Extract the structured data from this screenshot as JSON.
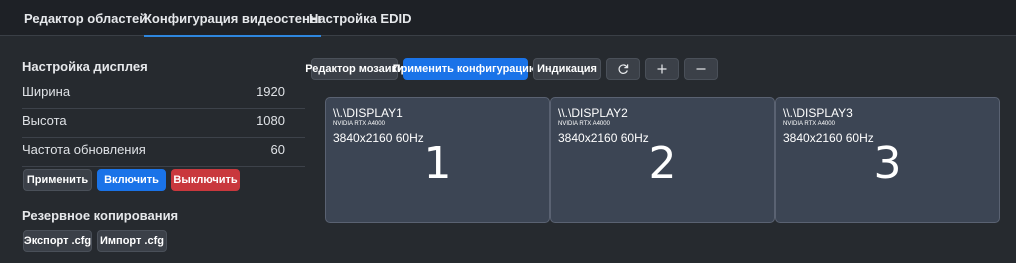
{
  "tabs": [
    {
      "label": "Редактор областей",
      "active": false
    },
    {
      "label": "Конфигурация видеостены",
      "active": true
    },
    {
      "label": "Настройка EDID",
      "active": false
    }
  ],
  "display_settings": {
    "title": "Настройка дисплея",
    "fields": [
      {
        "label": "Ширина",
        "value": "1920"
      },
      {
        "label": "Высота",
        "value": "1080"
      },
      {
        "label": "Частота обновления",
        "value": "60"
      }
    ],
    "apply_label": "Применить",
    "enable_label": "Включить",
    "disable_label": "Выключить"
  },
  "backup": {
    "title": "Резервное копирования",
    "export_label": "Экспорт .cfg",
    "import_label": "Импорт .cfg"
  },
  "toolbar": {
    "mosaic_editor_label": "Редактор мозаики",
    "apply_config_label": "Применить конфигурацию",
    "indication_label": "Индикация",
    "refresh_icon": "refresh-icon",
    "add_icon": "plus-icon",
    "remove_icon": "minus-icon"
  },
  "displays": [
    {
      "name": "\\\\.\\DISPLAY1",
      "gpu": "NVIDIA RTX A4000",
      "mode": "3840x2160 60Hz",
      "number": "1"
    },
    {
      "name": "\\\\.\\DISPLAY2",
      "gpu": "NVIDIA RTX A4000",
      "mode": "3840x2160 60Hz",
      "number": "2"
    },
    {
      "name": "\\\\.\\DISPLAY3",
      "gpu": "NVIDIA RTX A4000",
      "mode": "3840x2160 60Hz",
      "number": "3"
    }
  ],
  "colors": {
    "accent": "#2e86de",
    "primary_button": "#1a73e8",
    "danger_button": "#c9383d",
    "tile_background": "#3c4554",
    "page_background": "#262a2f"
  }
}
